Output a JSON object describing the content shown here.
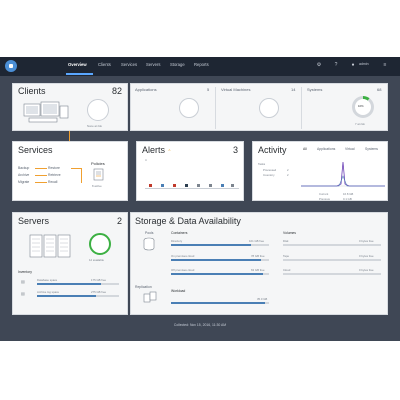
{
  "nav": {
    "items": [
      "Overview",
      "Clients",
      "Services",
      "Servers",
      "Storage",
      "Reports"
    ],
    "user": "admin"
  },
  "clients": {
    "title": "Clients",
    "count": "82",
    "circle_label": "None at risk",
    "applications": {
      "label": "Applications",
      "count": "5"
    },
    "virtual_machines": {
      "label": "Virtual Machines",
      "count": "14"
    },
    "systems": {
      "label": "Systems",
      "count": "68",
      "percent": "10%",
      "sub": "7 at risk",
      "ratio": 0.1
    }
  },
  "services": {
    "title": "Services",
    "policies": "Policies",
    "policies_sub": "8 active",
    "rows": [
      {
        "left": "Backup",
        "right": "Restore"
      },
      {
        "left": "Archive",
        "right": "Retrieve"
      },
      {
        "left": "Migrate",
        "right": "Recall"
      }
    ]
  },
  "alerts": {
    "title": "Alerts",
    "count": "3",
    "badge": "⚠",
    "axis_top": "4"
  },
  "activity": {
    "title": "Activity",
    "tabs": [
      "All",
      "Applications",
      "Virtual",
      "Systems"
    ],
    "legend": [
      {
        "label": "Tasks",
        "value": ""
      },
      {
        "label": "Processed",
        "value": "2"
      },
      {
        "label": "Inventory",
        "value": "2"
      }
    ],
    "bottom": [
      {
        "label": "Current",
        "value": "16.8 GB"
      },
      {
        "label": "Previous",
        "value": "0.1 GB"
      }
    ]
  },
  "servers": {
    "title": "Servers",
    "count": "2",
    "donut_label": "12 available",
    "inventory": "Inventory",
    "inventory_rows": [
      {
        "label": "Database space",
        "value": "175 GB free"
      },
      {
        "label": "Archive log space",
        "value": "275 GB free"
      }
    ]
  },
  "storage": {
    "title": "Storage & Data Availability",
    "pools": "Pools",
    "containers": "Containers",
    "volumes": "Volumes",
    "replication": "Replication",
    "workload": "Workload",
    "workload_value": "35.0 GB",
    "container_rows": [
      {
        "label": "Directory",
        "value": "101 GB free",
        "fill": 0.82
      },
      {
        "label": "On premises cloud",
        "value": "78 GB free",
        "fill": 0.92
      },
      {
        "label": "Off premises cloud",
        "value": "63 GB free",
        "fill": 0.94
      }
    ],
    "volume_rows": [
      {
        "label": "Disk",
        "value": "0 bytes free"
      },
      {
        "label": "Tape",
        "value": "0 bytes free"
      },
      {
        "label": "Cloud",
        "value": "0 bytes free"
      }
    ],
    "workload_fill": 0.96
  },
  "footer": "Collected: Nov 15, 2016, 11:30 AM",
  "colors": {
    "accent": "#4a7fb5",
    "green": "#3cb043",
    "orange": "#f0a030",
    "topbar": "#1e2633"
  }
}
